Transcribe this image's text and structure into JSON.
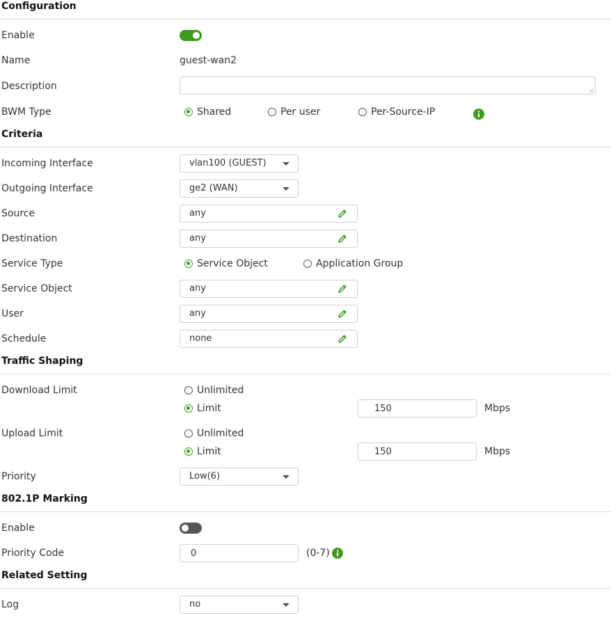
{
  "configuration": {
    "title": "Configuration",
    "enable_label": "Enable",
    "enable_on": true,
    "name_label": "Name",
    "name_value": "guest-wan2",
    "description_label": "Description",
    "description_value": "",
    "bwm_type_label": "BWM Type",
    "bwm_options": [
      "Shared",
      "Per user",
      "Per-Source-IP"
    ],
    "bwm_selected": "Shared"
  },
  "criteria": {
    "title": "Criteria",
    "incoming_label": "Incoming Interface",
    "incoming_value": "vlan100 (GUEST)",
    "outgoing_label": "Outgoing Interface",
    "outgoing_value": "ge2 (WAN)",
    "source_label": "Source",
    "source_value": "any",
    "destination_label": "Destination",
    "destination_value": "any",
    "service_type_label": "Service Type",
    "service_type_options": [
      "Service Object",
      "Application Group"
    ],
    "service_type_selected": "Service Object",
    "service_object_label": "Service Object",
    "service_object_value": "any",
    "user_label": "User",
    "user_value": "any",
    "schedule_label": "Schedule",
    "schedule_value": "none"
  },
  "traffic_shaping": {
    "title": "Traffic Shaping",
    "download_label": "Download Limit",
    "download_unlimited_label": "Unlimited",
    "download_limit_label": "Limit",
    "download_selected": "Limit",
    "download_value": "150",
    "download_unit": "Mbps",
    "upload_label": "Upload Limit",
    "upload_unlimited_label": "Unlimited",
    "upload_limit_label": "Limit",
    "upload_selected": "Limit",
    "upload_value": "150",
    "upload_unit": "Mbps",
    "priority_label": "Priority",
    "priority_value": "Low(6)"
  },
  "marking": {
    "title": "802.1P Marking",
    "enable_label": "Enable",
    "enable_on": false,
    "priority_code_label": "Priority Code",
    "priority_code_value": "0",
    "priority_code_range": "(0-7)"
  },
  "related": {
    "title": "Related Setting",
    "log_label": "Log",
    "log_value": "no"
  },
  "colors": {
    "accent": "#3f9a1f",
    "divider": "#dcdcdc"
  }
}
